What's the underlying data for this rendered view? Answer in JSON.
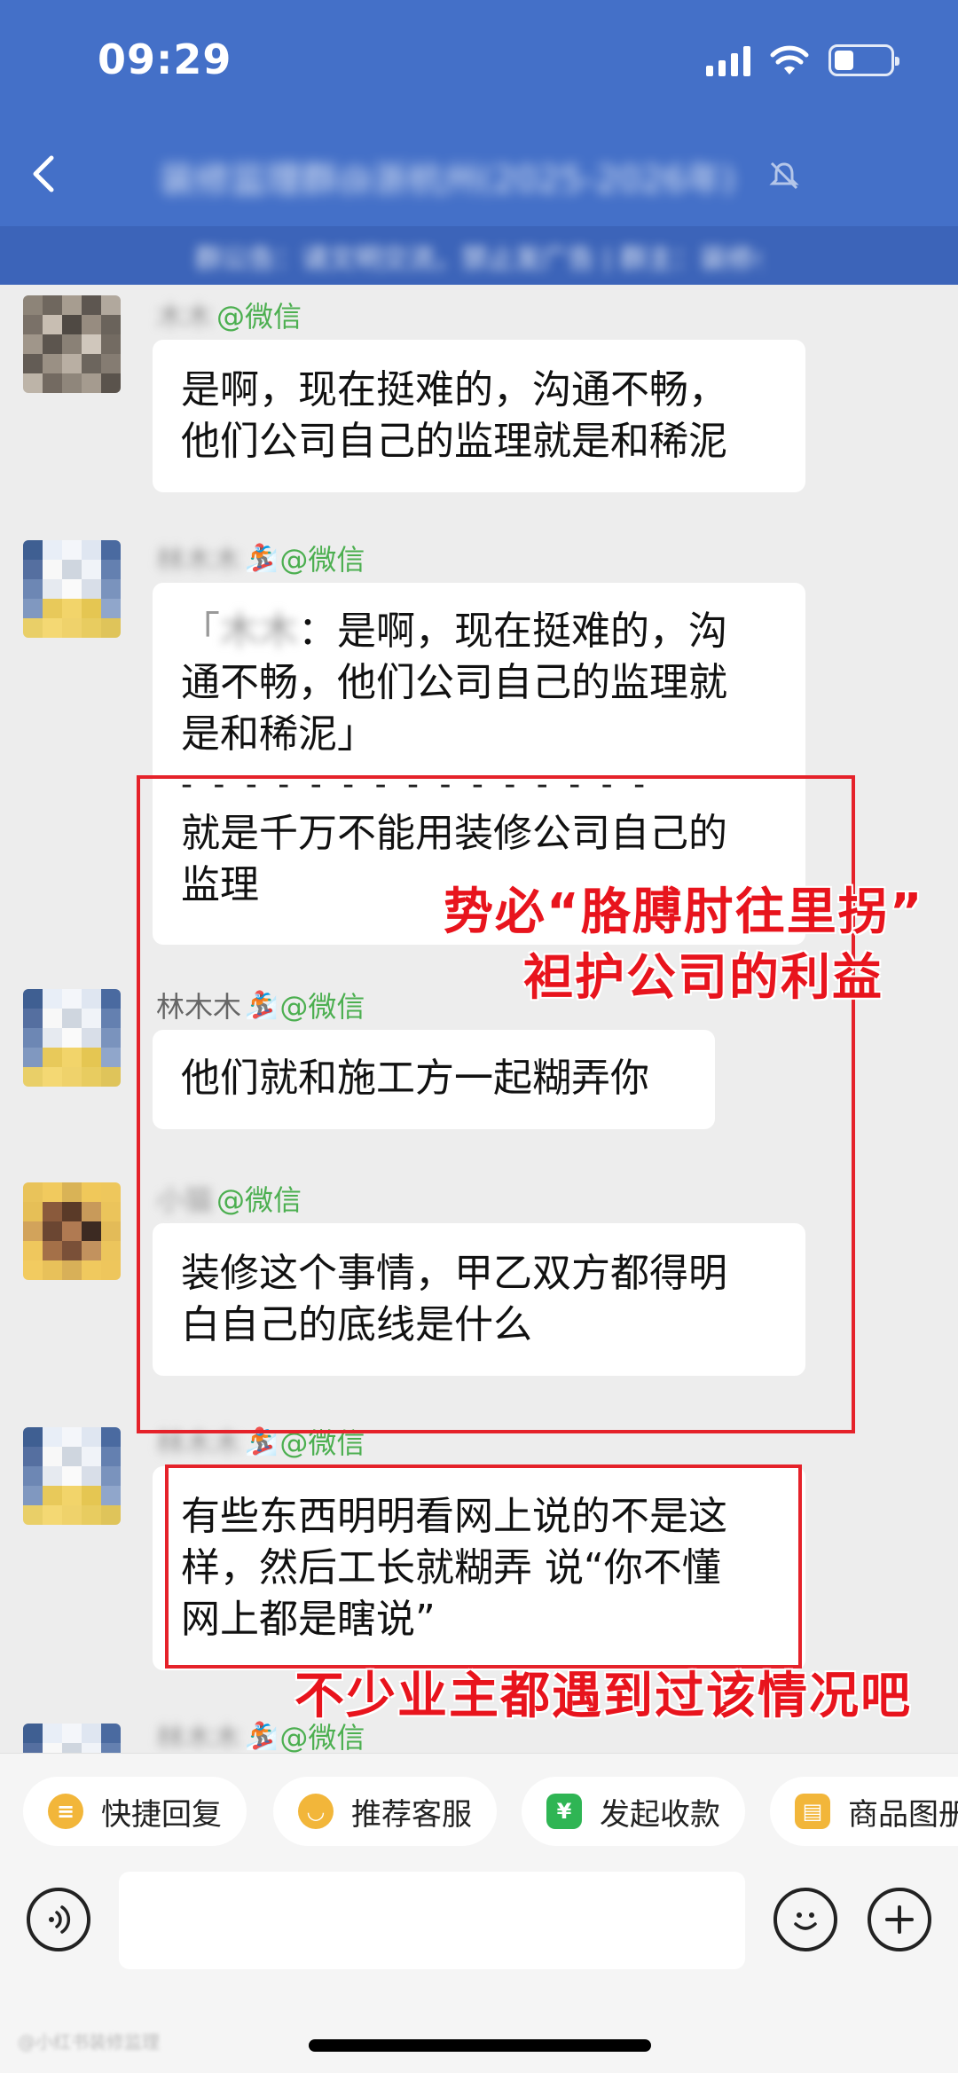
{
  "status": {
    "time": "09:29",
    "battery_level": 0.35
  },
  "header": {
    "title": "装修监理群@浙杭州(2025-2026年)",
    "notice": "群公告：请文明交流，禁止发广告 | 群主：装修小助手"
  },
  "messages": [
    {
      "name_blur": "木木",
      "name": "",
      "suffix": "@微信",
      "emoji": false,
      "lines": [
        "是啊，现在挺难的，沟通不畅，",
        "他们公司自己的监理就是和稀泥"
      ]
    },
    {
      "name_blur": "林木木",
      "name": "",
      "suffix": "@微信",
      "emoji": true,
      "quote_name": "木木",
      "quote_lines": [
        "：是啊，现在挺难的，沟",
        "通不畅，他们公司自己的监理就",
        "是和稀泥」"
      ],
      "divider": "- - - - - - - - - - - - - - -",
      "reply_lines": [
        "就是千万不能用装修公司自己的",
        "监理"
      ]
    },
    {
      "name_blur": "",
      "name": "林木木",
      "suffix": "@微信",
      "emoji": true,
      "lines": [
        "他们就和施工方一起糊弄你"
      ]
    },
    {
      "name_blur": "小猫",
      "name": "",
      "suffix": "@微信",
      "emoji": false,
      "lines": [
        "装修这个事情，甲乙双方都得明",
        "白自己的底线是什么"
      ]
    },
    {
      "name_blur": "林木木",
      "name": "",
      "suffix": "@微信",
      "emoji": true,
      "lines": [
        "有些东西明明看网上说的不是这",
        "样，然后工长就糊弄 说“你不懂",
        "网上都是瞎说”"
      ]
    },
    {
      "name_blur": "林木木",
      "name": "",
      "suffix": "@微信",
      "emoji": true,
      "lines": []
    }
  ],
  "annotations": {
    "a1_line1": "势必“胳膊肘往里拐”",
    "a1_line2": "袒护公司的利益",
    "a2": "不少业主都遇到过该情况吧"
  },
  "quick_actions": [
    "快捷回复",
    "推荐客服",
    "发起收款",
    "商品图册"
  ],
  "watermark": "@小红书装修监理"
}
